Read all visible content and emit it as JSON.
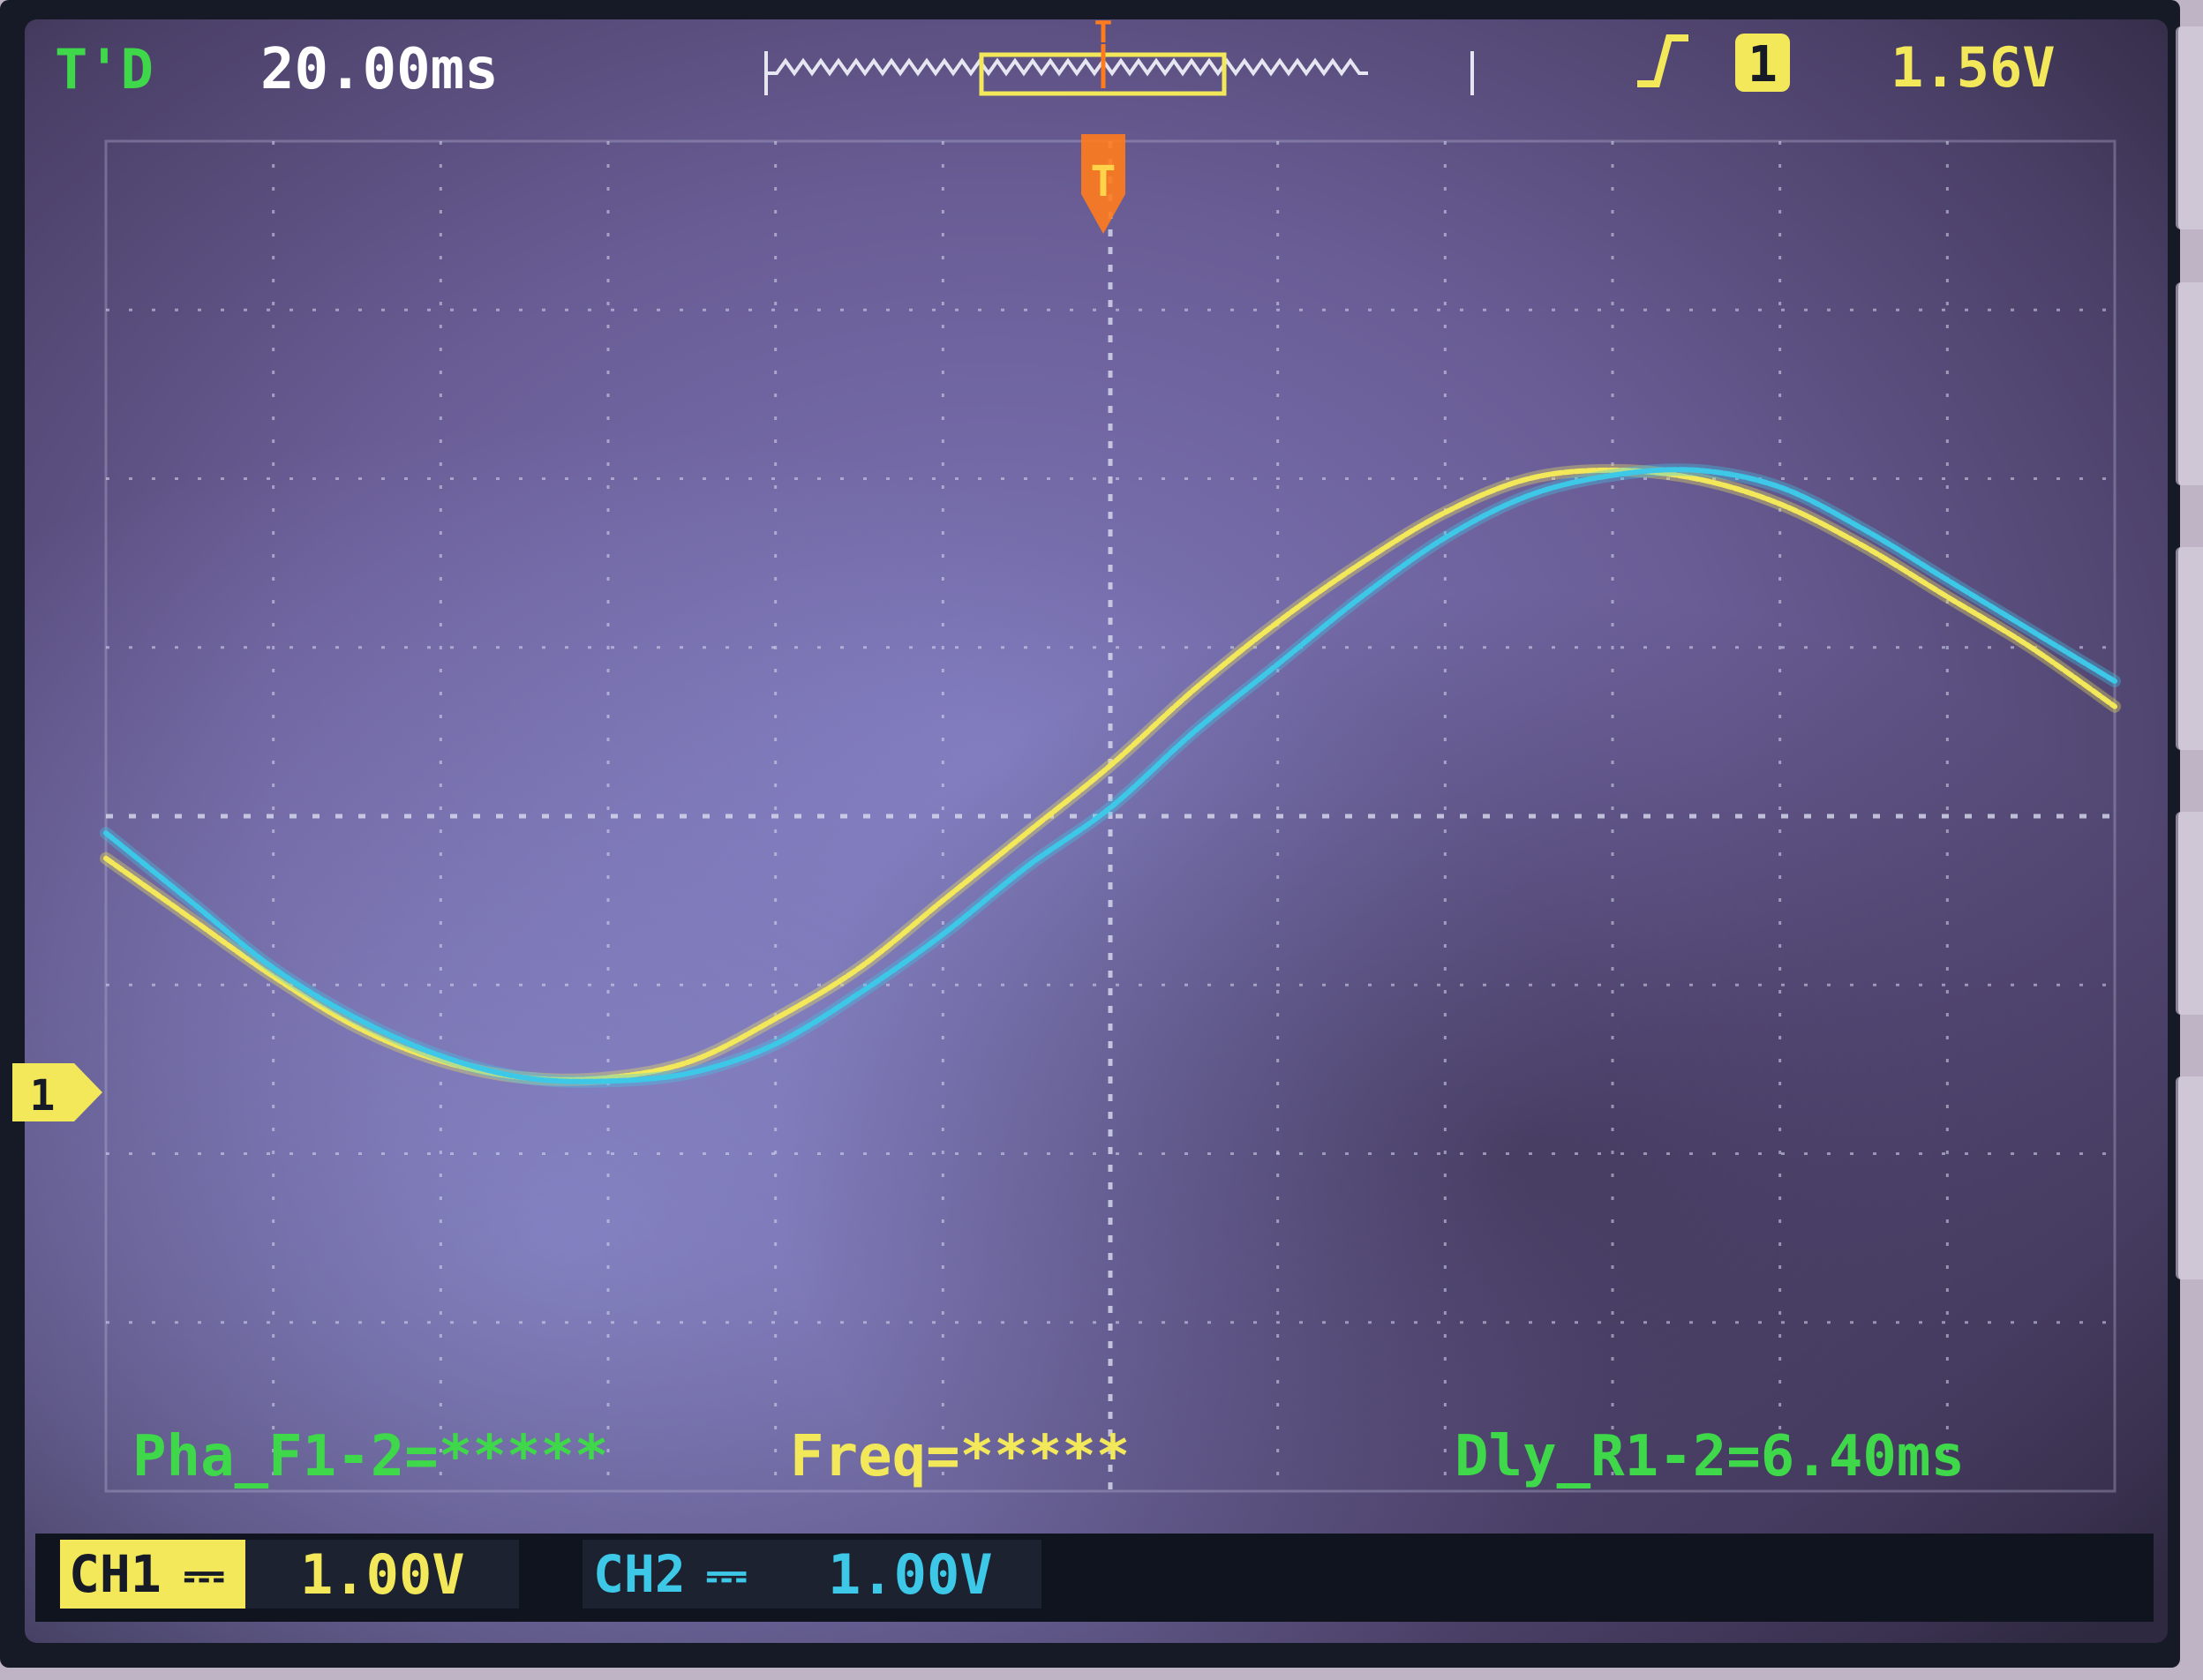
{
  "header": {
    "trig_status": "T'D",
    "timebase": "20.00ms",
    "trigger_source": "1",
    "trigger_level": "1.56V",
    "trigger_marker": "T"
  },
  "ground_marker": "1",
  "measurements": {
    "phase": "Pha_F1-2=*****",
    "freq": "Freq=*****",
    "delay": "Dly_R1-2=6.40ms"
  },
  "channels": {
    "ch1": {
      "label": "CH1",
      "coupling": "⎓",
      "scale": "1.00V"
    },
    "ch2": {
      "label": "CH2",
      "coupling": "⎓",
      "scale": "1.00V"
    }
  },
  "colors": {
    "ch1": "#f2e85a",
    "ch2": "#3ec8e8",
    "status": "#3fd84a",
    "trigger": "#ff7b1c",
    "text": "#ffffff",
    "grid": "#d9dcf0"
  },
  "icons": {
    "edge": "rising-edge-icon",
    "trigger_pos": "trigger-position-marker-icon",
    "ground": "ground-marker-icon"
  },
  "chart_data": {
    "type": "line",
    "grid": {
      "divisions_x": 12,
      "divisions_y": 8
    },
    "xlim": [
      -120,
      120
    ],
    "ylim": [
      -4,
      4
    ],
    "x_unit": "ms",
    "y_unit": "V",
    "series": [
      {
        "color": "#f2e85a",
        "x": [
          -120,
          -110,
          -100,
          -90,
          -80,
          -70,
          -60,
          -50,
          -40,
          -30,
          -20,
          -10,
          0,
          10,
          20,
          30,
          40,
          50,
          60,
          70,
          80,
          90,
          100,
          110,
          120
        ],
        "y": [
          -0.25,
          -0.6,
          -0.95,
          -1.25,
          -1.45,
          -1.55,
          -1.55,
          -1.45,
          -1.2,
          -0.9,
          -0.5,
          -0.1,
          0.3,
          0.75,
          1.15,
          1.5,
          1.8,
          2.0,
          2.05,
          2.0,
          1.85,
          1.6,
          1.3,
          1.0,
          0.65
        ]
      },
      {
        "color": "#3ec8e8",
        "x": [
          -120,
          -110,
          -100,
          -90,
          -80,
          -70,
          -60,
          -50,
          -40,
          -30,
          -20,
          -10,
          0,
          10,
          20,
          30,
          40,
          50,
          60,
          70,
          80,
          90,
          100,
          110,
          120
        ],
        "y": [
          -0.1,
          -0.5,
          -0.9,
          -1.2,
          -1.42,
          -1.55,
          -1.57,
          -1.52,
          -1.35,
          -1.05,
          -0.7,
          -0.3,
          0.05,
          0.5,
          0.9,
          1.3,
          1.65,
          1.9,
          2.02,
          2.05,
          1.95,
          1.7,
          1.4,
          1.1,
          0.8
        ]
      }
    ]
  }
}
